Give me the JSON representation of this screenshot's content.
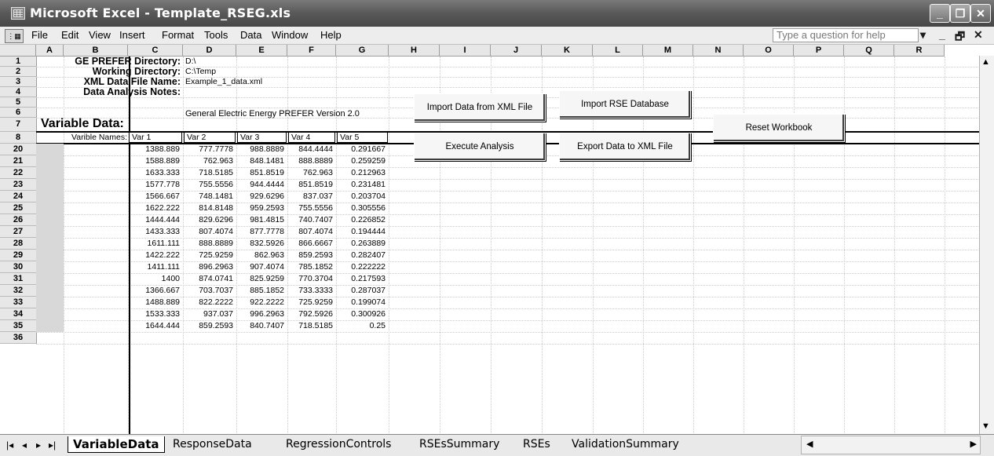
{
  "window": {
    "title": "Microsoft Excel - Template_RSEG.xls",
    "minimize": "_",
    "restore": "❐",
    "close": "✕"
  },
  "menu": {
    "items": [
      "File",
      "Edit",
      "View",
      "Insert",
      "Format",
      "Tools",
      "Data",
      "Window",
      "Help"
    ],
    "ask_placeholder": "Type a question for help",
    "controls": [
      "▾",
      "_",
      "🗗",
      "✕"
    ]
  },
  "columns": [
    "A",
    "B",
    "C",
    "D",
    "E",
    "F",
    "G",
    "H",
    "I",
    "J",
    "K",
    "L",
    "M",
    "N",
    "O",
    "P",
    "Q",
    "R"
  ],
  "rows": [
    "1",
    "2",
    "3",
    "4",
    "5",
    "6",
    "7",
    "8",
    "20",
    "21",
    "22",
    "23",
    "24",
    "25",
    "26",
    "27",
    "28",
    "29",
    "30",
    "31",
    "32",
    "33",
    "34",
    "35",
    "36"
  ],
  "labels": {
    "ge_prefer_dir": "GE PREFER Directory:",
    "working_dir": "Working Directory:",
    "xml_file": "XML Data File Name:",
    "notes": "Data Analysis Notes:",
    "dir_value": "D:\\",
    "working_value": "C:\\Temp",
    "xml_value": "Example_1_data.xml",
    "version": "General Electric Energy PREFER Version 2.0",
    "variable_data": "Variable Data:",
    "var_names": "Varible Names:"
  },
  "var_headers": [
    "Var 1",
    "Var 2",
    "Var 3",
    "Var 4",
    "Var 5"
  ],
  "buttons": {
    "import_xml": "Import Data from XML File",
    "import_rse": "Import RSE Database",
    "execute": "Execute Analysis",
    "export_xml": "Export Data to XML File",
    "reset": "Reset Workbook"
  },
  "table": [
    [
      "1388.889",
      "777.7778",
      "988.8889",
      "844.4444",
      "0.291667"
    ],
    [
      "1588.889",
      "762.963",
      "848.1481",
      "888.8889",
      "0.259259"
    ],
    [
      "1633.333",
      "718.5185",
      "851.8519",
      "762.963",
      "0.212963"
    ],
    [
      "1577.778",
      "755.5556",
      "944.4444",
      "851.8519",
      "0.231481"
    ],
    [
      "1566.667",
      "748.1481",
      "929.6296",
      "837.037",
      "0.203704"
    ],
    [
      "1622.222",
      "814.8148",
      "959.2593",
      "755.5556",
      "0.305556"
    ],
    [
      "1444.444",
      "829.6296",
      "981.4815",
      "740.7407",
      "0.226852"
    ],
    [
      "1433.333",
      "807.4074",
      "877.7778",
      "807.4074",
      "0.194444"
    ],
    [
      "1611.111",
      "888.8889",
      "832.5926",
      "866.6667",
      "0.263889"
    ],
    [
      "1422.222",
      "725.9259",
      "862.963",
      "859.2593",
      "0.282407"
    ],
    [
      "1411.111",
      "896.2963",
      "907.4074",
      "785.1852",
      "0.222222"
    ],
    [
      "1400",
      "874.0741",
      "825.9259",
      "770.3704",
      "0.217593"
    ],
    [
      "1366.667",
      "703.7037",
      "885.1852",
      "733.3333",
      "0.287037"
    ],
    [
      "1488.889",
      "822.2222",
      "922.2222",
      "725.9259",
      "0.199074"
    ],
    [
      "1533.333",
      "937.037",
      "996.2963",
      "792.5926",
      "0.300926"
    ],
    [
      "1644.444",
      "859.2593",
      "840.7407",
      "718.5185",
      "0.25"
    ]
  ],
  "tabs": [
    "VariableData",
    "ResponseData",
    "RegressionControls",
    "RSEsSummary",
    "RSEs",
    "ValidationSummary"
  ],
  "tab_nav": [
    "|◂",
    "◂",
    "▸",
    "▸|"
  ]
}
